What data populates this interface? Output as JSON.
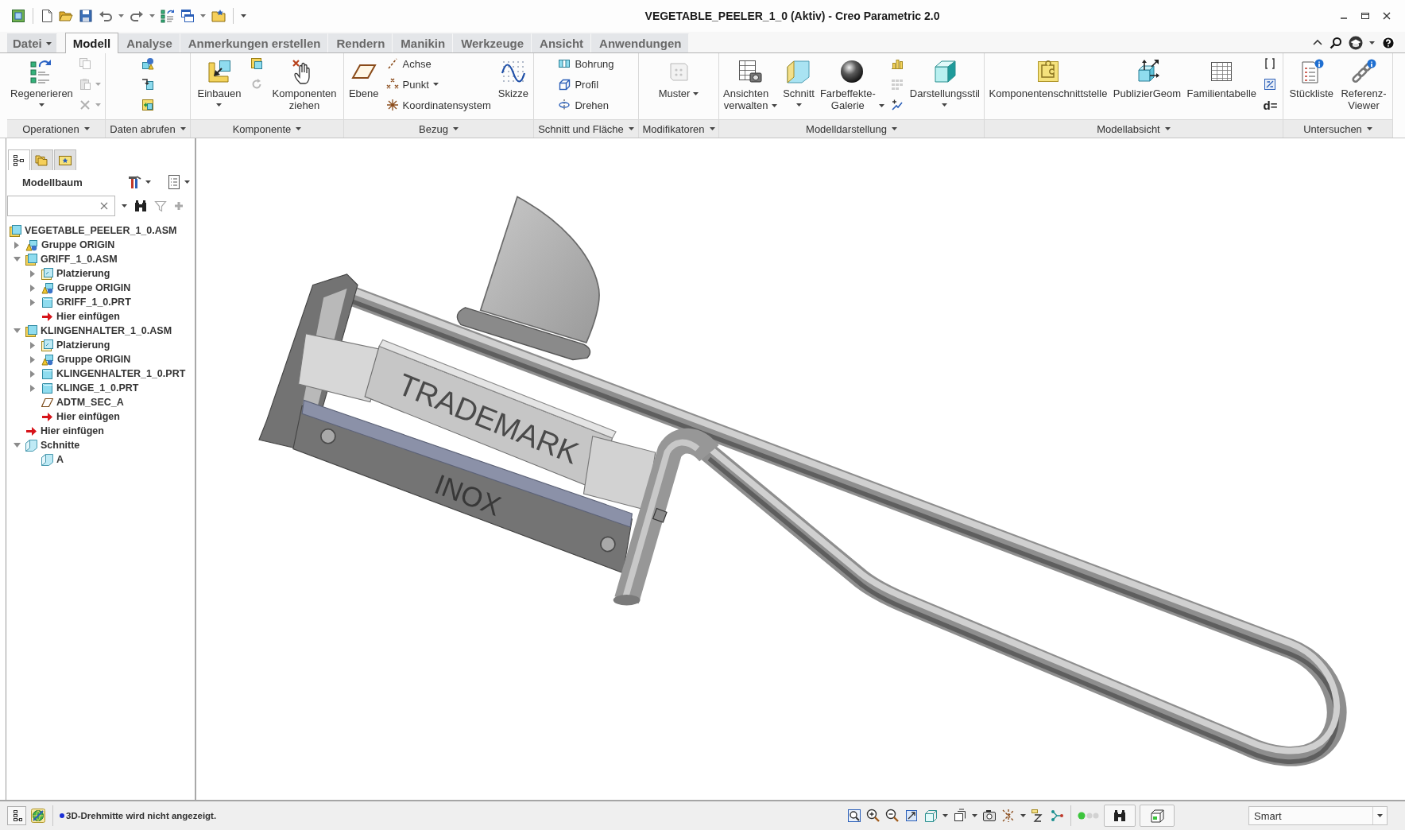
{
  "window": {
    "title": "VEGETABLE_PEELER_1_0 (Aktiv) - Creo Parametric 2.0"
  },
  "tabs": [
    {
      "kind": "menu",
      "label": "Datei",
      "selected": false
    },
    {
      "kind": "tab",
      "label": "Modell",
      "selected": true
    },
    {
      "kind": "tab",
      "label": "Analyse",
      "selected": false
    },
    {
      "kind": "tab",
      "label": "Anmerkungen erstellen",
      "selected": false
    },
    {
      "kind": "tab",
      "label": "Rendern",
      "selected": false
    },
    {
      "kind": "tab",
      "label": "Manikin",
      "selected": false
    },
    {
      "kind": "tab",
      "label": "Werkzeuge",
      "selected": false
    },
    {
      "kind": "tab",
      "label": "Ansicht",
      "selected": false
    },
    {
      "kind": "tab",
      "label": "Anwendungen",
      "selected": false
    }
  ],
  "ribbon": {
    "groups": [
      {
        "label": "Operationen",
        "items": [
          {
            "kind": "split",
            "label": "Regenerieren"
          },
          {
            "kind": "icon",
            "disabled": true,
            "dropdown": false
          },
          {
            "kind": "icon",
            "disabled": true,
            "dropdown": true
          },
          {
            "kind": "icon",
            "disabled": true,
            "dropdown": true
          }
        ]
      },
      {
        "label": "Daten abrufen",
        "items": [
          {
            "kind": "icon",
            "disabled": false,
            "dropdown": false
          },
          {
            "kind": "icon",
            "disabled": false,
            "dropdown": false
          },
          {
            "kind": "icon",
            "disabled": false,
            "dropdown": false
          }
        ]
      },
      {
        "label": "Komponente",
        "items": [
          {
            "kind": "split",
            "label": "Einbauen"
          },
          {
            "kind": "icon",
            "disabled": false,
            "dropdown": false
          },
          {
            "kind": "icon",
            "disabled": true,
            "dropdown": false
          },
          {
            "kind": "plain",
            "label": "Komponenten ziehen"
          }
        ]
      },
      {
        "label": "Bezug",
        "items": [
          {
            "kind": "plain",
            "label": "Ebene"
          },
          {
            "kind": "row",
            "label": "Achse",
            "dropdown": false
          },
          {
            "kind": "row",
            "label": "Punkt",
            "dropdown": true
          },
          {
            "kind": "row",
            "label": "Koordinatensystem",
            "dropdown": false
          },
          {
            "kind": "plain",
            "label": "Skizze"
          }
        ]
      },
      {
        "label": "Schnitt und Fläche",
        "items": [
          {
            "kind": "row",
            "label": "Bohrung",
            "dropdown": false
          },
          {
            "kind": "row",
            "label": "Profil",
            "dropdown": false
          },
          {
            "kind": "row",
            "label": "Drehen",
            "dropdown": false
          }
        ]
      },
      {
        "label": "Modifikatoren",
        "items": [
          {
            "kind": "menu",
            "label": "Muster"
          }
        ]
      },
      {
        "label": "Modelldarstellung",
        "items": [
          {
            "kind": "menu",
            "label": "Ansichten verwalten"
          },
          {
            "kind": "split",
            "label": "Schnitt"
          },
          {
            "kind": "menu",
            "label": "Farbeffekte-Galerie"
          },
          {
            "kind": "icon",
            "disabled": false,
            "dropdown": false
          },
          {
            "kind": "icon",
            "disabled": true,
            "dropdown": false
          },
          {
            "kind": "icon",
            "disabled": false,
            "dropdown": false
          },
          {
            "kind": "split",
            "label": "Darstellungsstil"
          }
        ]
      },
      {
        "label": "Modellabsicht",
        "items": [
          {
            "kind": "plain",
            "label": "Komponentenschnittstelle"
          },
          {
            "kind": "plain",
            "label": "PublizierGeom"
          },
          {
            "kind": "plain",
            "label": "Familientabelle"
          },
          {
            "kind": "icon",
            "disabled": false,
            "dropdown": false
          },
          {
            "kind": "icon",
            "disabled": false,
            "dropdown": false
          },
          {
            "kind": "glyph",
            "label": "d="
          }
        ]
      },
      {
        "label": "Untersuchen",
        "items": [
          {
            "kind": "plain",
            "label": "Stückliste"
          },
          {
            "kind": "plain",
            "label": "Referenz-Viewer"
          }
        ]
      }
    ]
  },
  "navigator": {
    "tabs": [
      {
        "selected": true
      },
      {
        "selected": false
      },
      {
        "selected": false
      }
    ],
    "title": "Modellbaum",
    "tree": [
      {
        "label": "VEGETABLE_PEELER_1_0.ASM",
        "kind": "assembly",
        "children": [
          {
            "label": "Gruppe ORIGIN",
            "kind": "group",
            "expanded": false
          },
          {
            "label": "GRIFF_1_0.ASM",
            "kind": "assembly",
            "expanded": true,
            "children": [
              {
                "label": "Platzierung",
                "kind": "placement",
                "expanded": false
              },
              {
                "label": "Gruppe ORIGIN",
                "kind": "group",
                "expanded": false
              },
              {
                "label": "GRIFF_1_0.PRT",
                "kind": "part",
                "expanded": false
              },
              {
                "label": "Hier einfügen",
                "kind": "insert"
              }
            ]
          },
          {
            "label": "KLINGENHALTER_1_0.ASM",
            "kind": "assembly",
            "expanded": true,
            "children": [
              {
                "label": "Platzierung",
                "kind": "placement",
                "expanded": false
              },
              {
                "label": "Gruppe ORIGIN",
                "kind": "group",
                "expanded": false
              },
              {
                "label": "KLINGENHALTER_1_0.PRT",
                "kind": "part",
                "expanded": false
              },
              {
                "label": "KLINGE_1_0.PRT",
                "kind": "part",
                "expanded": false
              },
              {
                "label": "ADTM_SEC_A",
                "kind": "datum"
              },
              {
                "label": "Hier einfügen",
                "kind": "insert"
              }
            ]
          },
          {
            "label": "Hier einfügen",
            "kind": "insert"
          },
          {
            "label": "Schnitte",
            "kind": "sections",
            "expanded": true,
            "children": [
              {
                "label": "A",
                "kind": "section"
              }
            ]
          }
        ]
      }
    ]
  },
  "viewport": {
    "engraved_texts": [
      "TRADEMARK",
      "INOX"
    ]
  },
  "status_bar": {
    "message": "3D-Drehmitte wird nicht angezeigt.",
    "filter": {
      "value": "Smart"
    }
  }
}
